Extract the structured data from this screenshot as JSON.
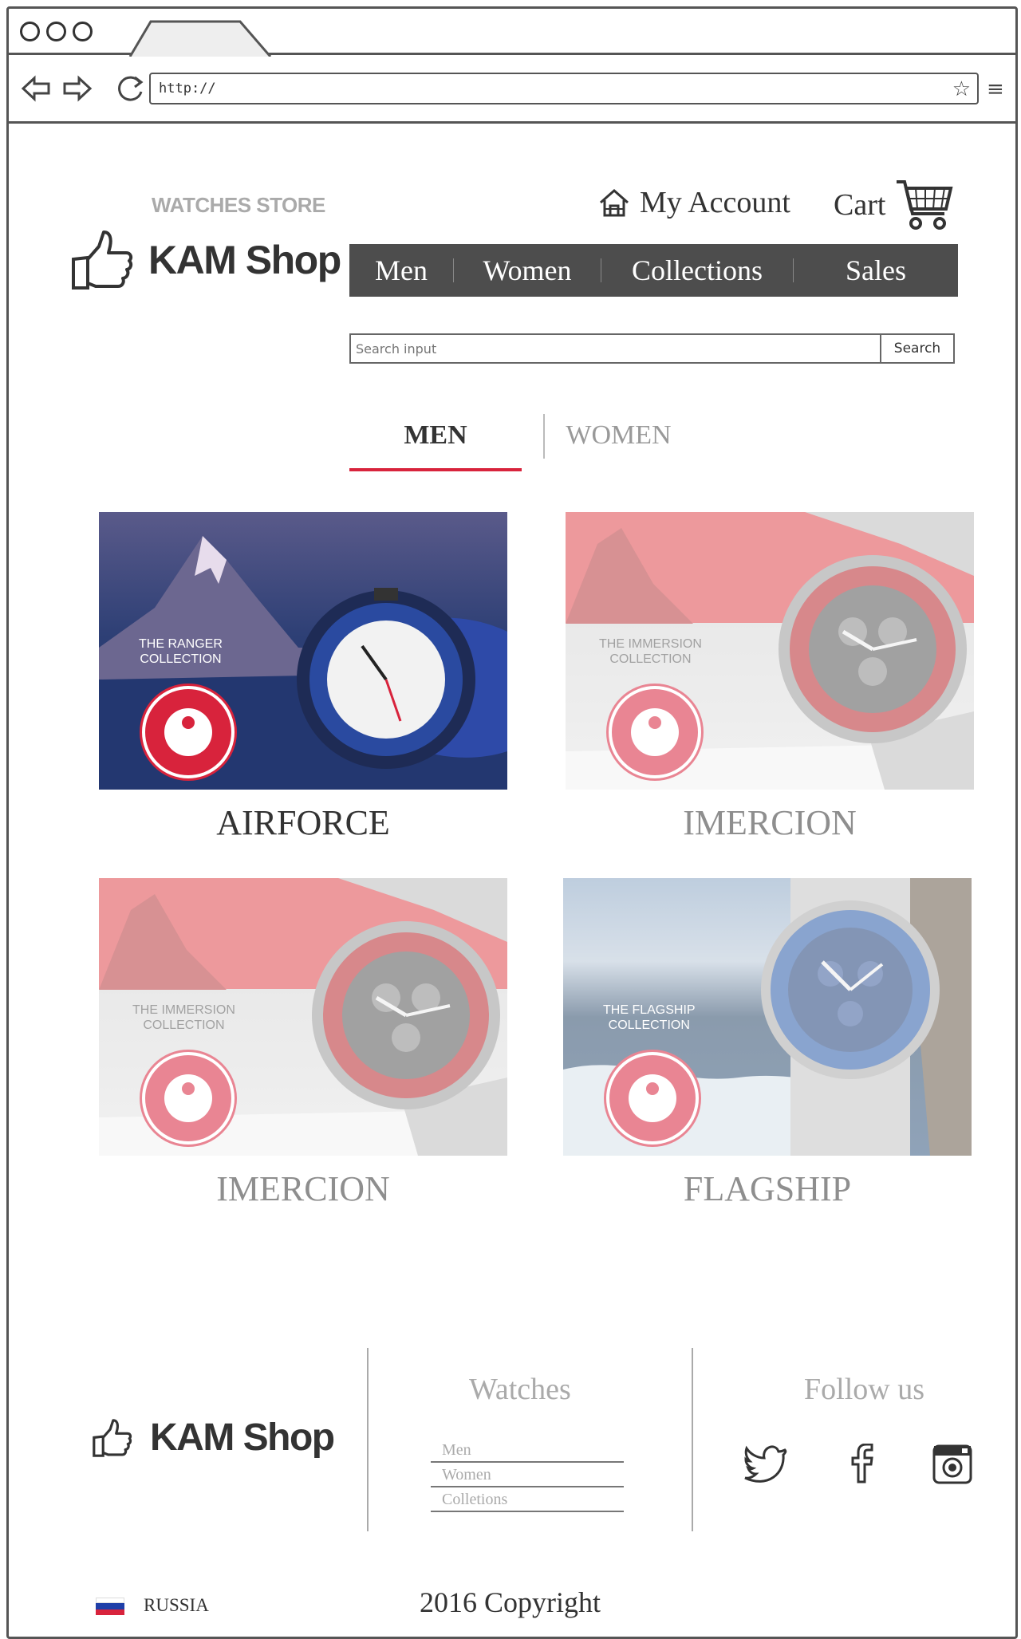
{
  "browser": {
    "url": "http://"
  },
  "header": {
    "tagline": "WATCHES STORE",
    "logo_text": "KAM Shop",
    "account_label": "My Account",
    "cart_label": "Cart"
  },
  "nav": {
    "items": [
      "Men",
      "Women",
      "Collections",
      "Sales"
    ]
  },
  "search": {
    "placeholder": "Search input",
    "button_label": "Search"
  },
  "tabs": {
    "men": "MEN",
    "women": "WOMEN"
  },
  "products": [
    {
      "name": "AIRFORCE",
      "collection_line1": "THE RANGER",
      "collection_line2": "COLLECTION"
    },
    {
      "name": "IMERCION",
      "collection_line1": "THE IMMERSION",
      "collection_line2": "COLLECTION"
    },
    {
      "name": "IMERCION",
      "collection_line1": "THE IMMERSION",
      "collection_line2": "COLLECTION"
    },
    {
      "name": "FLAGSHIP",
      "collection_line1": "THE FLAGSHIP",
      "collection_line2": "COLLECTION"
    }
  ],
  "footer": {
    "logo_text": "KAM Shop",
    "watches_title": "Watches",
    "links": [
      "Men",
      "Women",
      "Colletions"
    ],
    "follow_title": "Follow us",
    "country": "RUSSIA",
    "copyright": "2016 Copyright"
  },
  "colors": {
    "nav_bg": "#4d4d4d",
    "accent": "#d8233c"
  },
  "icons": {
    "home": "home-icon",
    "cart": "shopping-cart-icon",
    "logo": "thumbs-up-icon",
    "twitter": "twitter-icon",
    "facebook": "facebook-icon",
    "instagram": "instagram-icon"
  }
}
